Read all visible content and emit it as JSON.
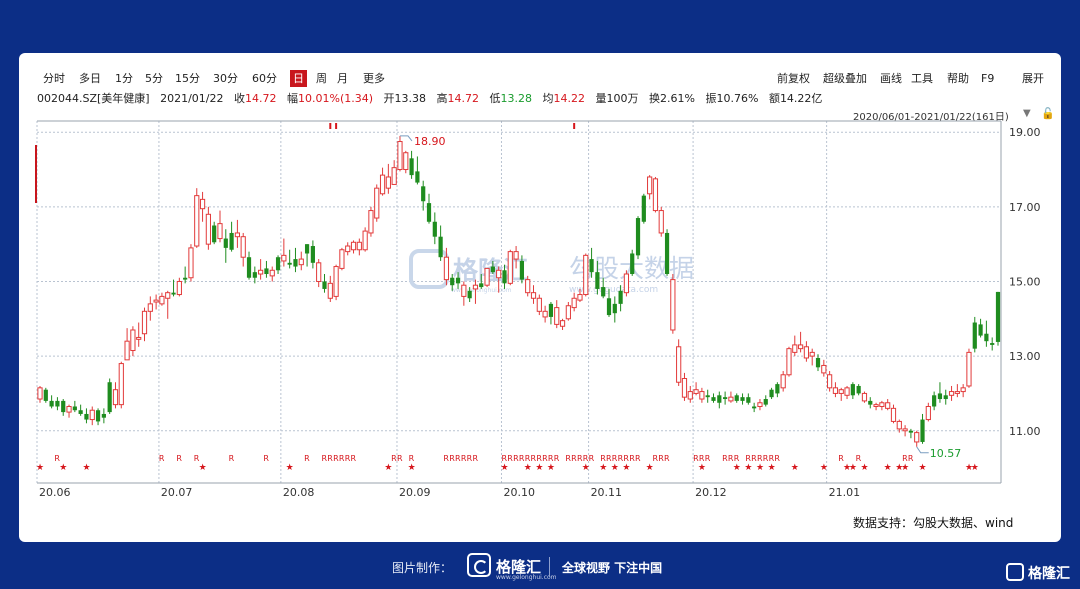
{
  "toolbar": {
    "left_items": [
      "分时",
      "多日",
      "1分",
      "5分",
      "15分",
      "30分",
      "60分",
      "日",
      "周",
      "月",
      "更多"
    ],
    "active_item": "日",
    "right_items": [
      "前复权",
      "超级叠加",
      "画线",
      "工具",
      "帮助",
      "F9",
      "展开"
    ]
  },
  "info": {
    "code_name": "002044.SZ[美年健康]",
    "date": "2021/01/22",
    "close_label": "收",
    "close": "14.72",
    "change_label": "幅",
    "change": "10.01%(1.34)",
    "open_label": "开",
    "open": "13.38",
    "high_label": "高",
    "high": "14.72",
    "low_label": "低",
    "low": "13.28",
    "avg_label": "均",
    "avg": "14.22",
    "vol_label": "量",
    "vol": "100万",
    "turnover_label": "换",
    "turnover": "2.61%",
    "amplitude_label": "振",
    "amplitude": "10.76%",
    "amount_label": "额",
    "amount": "14.22亿"
  },
  "range_label": "2020/06/01-2021/01/22(161日)",
  "range_arrow": "▼",
  "lock_icon": "🔓",
  "watermark": {
    "brand": "格隆汇",
    "brand_url": "www.gelonghui.com",
    "text": "勾股大数据",
    "url": "www.gogudata.com"
  },
  "source": "数据支持：勾股大数据、wind",
  "footer": {
    "made_by": "图片制作：",
    "brand": "格隆汇",
    "brand_url": "www.gelonghui.com",
    "slogan": "全球视野 下注中国",
    "brand_br": "格隆汇"
  },
  "chart_data": {
    "type": "candlestick",
    "ylim": [
      9.6,
      19.3
    ],
    "yticks": [
      "19.00",
      "17.00",
      "15.00",
      "13.00",
      "11.00"
    ],
    "ytick_values": [
      19,
      17,
      15,
      13,
      11
    ],
    "xticks": [
      "20.06",
      "20.07",
      "20.08",
      "20.09",
      "20.10",
      "20.11",
      "20.12",
      "21.01"
    ],
    "xtick_index": [
      0,
      21,
      42,
      62,
      80,
      95,
      113,
      136
    ],
    "max_label": "18.90",
    "min_label": "10.57",
    "colors": {
      "up": "#e23a3a",
      "down": "#1f8c1f",
      "grid": "#b9c3d1",
      "marker": "#d6161c"
    },
    "up_days": [
      0,
      5,
      9,
      13,
      14,
      15,
      16,
      17,
      18,
      19,
      20,
      21,
      22,
      24,
      26,
      27,
      28,
      29,
      31,
      34,
      35,
      38,
      40,
      42,
      45,
      48,
      50,
      51,
      52,
      53,
      54,
      55,
      56,
      57,
      58,
      59,
      60,
      61,
      62,
      63,
      70,
      73,
      75,
      77,
      79,
      81,
      82,
      84,
      85,
      86,
      87,
      89,
      90,
      91,
      92,
      93,
      94,
      101,
      105,
      106,
      107,
      109,
      110,
      111,
      112,
      113,
      114,
      119,
      124,
      128,
      129,
      130,
      131,
      132,
      133,
      135,
      136,
      137,
      138,
      139,
      142,
      144,
      145,
      146,
      147,
      148,
      149,
      151,
      153,
      157,
      158,
      159,
      160
    ],
    "ohlc": [
      [
        11.85,
        12.2,
        11.75,
        12.15
      ],
      [
        12.1,
        12.15,
        11.75,
        11.8
      ],
      [
        11.8,
        11.95,
        11.6,
        11.65
      ],
      [
        11.65,
        11.9,
        11.55,
        11.8
      ],
      [
        11.8,
        11.85,
        11.4,
        11.5
      ],
      [
        11.5,
        11.7,
        11.35,
        11.65
      ],
      [
        11.65,
        11.8,
        11.5,
        11.55
      ],
      [
        11.55,
        11.7,
        11.4,
        11.45
      ],
      [
        11.45,
        11.6,
        11.2,
        11.3
      ],
      [
        11.3,
        11.65,
        11.15,
        11.55
      ],
      [
        11.55,
        11.6,
        11.15,
        11.25
      ],
      [
        11.35,
        11.6,
        11.2,
        11.45
      ],
      [
        11.5,
        12.4,
        11.45,
        12.3
      ],
      [
        12.1,
        12.3,
        11.6,
        11.7
      ],
      [
        11.7,
        12.85,
        11.6,
        12.8
      ],
      [
        12.9,
        13.75,
        12.9,
        13.4
      ],
      [
        13.15,
        13.8,
        13.0,
        13.7
      ],
      [
        13.45,
        13.9,
        13.25,
        13.5
      ],
      [
        13.6,
        14.3,
        13.4,
        14.2
      ],
      [
        14.2,
        14.6,
        13.95,
        14.4
      ],
      [
        14.45,
        14.65,
        14.25,
        14.5
      ],
      [
        14.4,
        14.7,
        14.35,
        14.6
      ],
      [
        14.55,
        14.75,
        14.0,
        14.7
      ],
      [
        14.7,
        15.05,
        14.6,
        14.65
      ],
      [
        14.65,
        15.1,
        14.6,
        15.0
      ],
      [
        15.05,
        15.4,
        14.95,
        15.1
      ],
      [
        15.1,
        16.0,
        15.0,
        15.9
      ],
      [
        15.95,
        17.5,
        15.9,
        17.3
      ],
      [
        17.2,
        17.4,
        16.6,
        16.95
      ],
      [
        16.8,
        17.0,
        15.85,
        16.0
      ],
      [
        16.05,
        16.6,
        16.0,
        16.5
      ],
      [
        16.55,
        16.9,
        16.05,
        16.15
      ],
      [
        16.15,
        16.4,
        15.5,
        15.9
      ],
      [
        15.85,
        16.6,
        15.8,
        16.3
      ],
      [
        16.3,
        16.65,
        15.9,
        16.2
      ],
      [
        16.2,
        16.3,
        15.4,
        15.65
      ],
      [
        15.65,
        15.8,
        15.05,
        15.1
      ],
      [
        15.1,
        15.4,
        14.95,
        15.25
      ],
      [
        15.2,
        15.6,
        15.05,
        15.3
      ],
      [
        15.35,
        15.55,
        15.1,
        15.2
      ],
      [
        15.15,
        15.4,
        15.0,
        15.3
      ],
      [
        15.3,
        15.7,
        15.2,
        15.65
      ],
      [
        15.7,
        16.15,
        15.4,
        15.55
      ],
      [
        15.45,
        15.85,
        15.35,
        15.5
      ],
      [
        15.6,
        15.9,
        15.25,
        15.4
      ],
      [
        15.45,
        15.8,
        15.3,
        15.6
      ],
      [
        15.75,
        16.0,
        15.4,
        16.0
      ],
      [
        15.95,
        16.1,
        15.35,
        15.5
      ],
      [
        15.5,
        15.6,
        14.85,
        15.0
      ],
      [
        15.0,
        15.2,
        14.7,
        14.8
      ],
      [
        14.95,
        15.15,
        14.45,
        14.55
      ],
      [
        14.6,
        15.45,
        14.5,
        15.4
      ],
      [
        15.35,
        15.9,
        15.3,
        15.85
      ],
      [
        15.8,
        16.05,
        15.7,
        15.95
      ],
      [
        15.85,
        16.1,
        15.75,
        16.05
      ],
      [
        16.05,
        16.15,
        15.7,
        15.85
      ],
      [
        15.85,
        16.45,
        15.8,
        16.35
      ],
      [
        16.3,
        17.0,
        16.2,
        16.9
      ],
      [
        16.7,
        17.6,
        16.6,
        17.5
      ],
      [
        17.35,
        18.05,
        17.3,
        17.85
      ],
      [
        17.5,
        18.15,
        17.35,
        17.8
      ],
      [
        17.6,
        18.25,
        17.6,
        18.05
      ],
      [
        18.0,
        18.9,
        17.95,
        18.75
      ],
      [
        18.0,
        18.5,
        17.9,
        18.45
      ],
      [
        18.3,
        18.5,
        17.75,
        17.85
      ],
      [
        17.95,
        18.35,
        17.6,
        17.65
      ],
      [
        17.55,
        17.7,
        16.9,
        17.15
      ],
      [
        17.1,
        17.35,
        16.55,
        16.6
      ],
      [
        16.6,
        16.85,
        16.0,
        16.2
      ],
      [
        16.2,
        16.5,
        15.55,
        15.65
      ],
      [
        15.65,
        15.9,
        14.9,
        15.05
      ],
      [
        14.9,
        15.2,
        14.75,
        15.1
      ],
      [
        15.1,
        15.25,
        14.8,
        14.95
      ],
      [
        14.9,
        15.0,
        14.35,
        14.6
      ],
      [
        14.55,
        14.85,
        14.45,
        14.75
      ],
      [
        14.8,
        15.05,
        14.4,
        14.9
      ],
      [
        14.85,
        15.2,
        14.8,
        14.95
      ],
      [
        14.9,
        15.35,
        14.85,
        15.35
      ],
      [
        15.4,
        15.55,
        15.2,
        15.25
      ],
      [
        15.1,
        15.4,
        14.7,
        15.3
      ],
      [
        15.3,
        15.45,
        14.8,
        14.95
      ],
      [
        14.95,
        15.85,
        14.9,
        15.8
      ],
      [
        15.8,
        15.95,
        15.35,
        15.6
      ],
      [
        15.55,
        15.7,
        14.95,
        15.05
      ],
      [
        15.05,
        15.15,
        14.6,
        14.7
      ],
      [
        14.7,
        14.9,
        14.4,
        14.55
      ],
      [
        14.55,
        14.65,
        14.1,
        14.2
      ],
      [
        14.2,
        14.35,
        13.9,
        14.05
      ],
      [
        14.05,
        14.45,
        13.85,
        14.4
      ],
      [
        14.3,
        14.5,
        13.75,
        13.85
      ],
      [
        13.8,
        14.0,
        13.7,
        13.95
      ],
      [
        14.0,
        14.45,
        13.95,
        14.35
      ],
      [
        14.3,
        14.7,
        14.2,
        14.55
      ],
      [
        14.5,
        14.8,
        14.45,
        14.65
      ],
      [
        14.65,
        15.75,
        14.6,
        15.7
      ],
      [
        15.6,
        15.9,
        15.1,
        15.25
      ],
      [
        15.25,
        15.55,
        14.65,
        14.8
      ],
      [
        14.85,
        15.1,
        14.55,
        14.6
      ],
      [
        14.55,
        14.8,
        14.05,
        14.1
      ],
      [
        14.15,
        14.6,
        13.9,
        14.4
      ],
      [
        14.4,
        14.9,
        14.2,
        14.75
      ],
      [
        14.7,
        15.3,
        14.6,
        15.2
      ],
      [
        15.2,
        15.85,
        15.15,
        15.75
      ],
      [
        15.7,
        16.75,
        15.6,
        16.7
      ],
      [
        16.6,
        17.35,
        16.55,
        17.3
      ],
      [
        17.35,
        17.85,
        17.2,
        17.8
      ],
      [
        17.75,
        17.8,
        16.85,
        16.9
      ],
      [
        16.9,
        17.0,
        16.2,
        16.3
      ],
      [
        16.3,
        16.4,
        15.15,
        15.2
      ],
      [
        15.05,
        15.2,
        13.6,
        13.7
      ],
      [
        13.25,
        13.45,
        12.2,
        12.3
      ],
      [
        12.4,
        12.55,
        11.8,
        11.9
      ],
      [
        11.85,
        12.2,
        11.75,
        12.05
      ],
      [
        12.1,
        12.3,
        11.95,
        12.0
      ],
      [
        12.05,
        12.15,
        11.75,
        11.85
      ],
      [
        11.9,
        12.1,
        11.75,
        11.95
      ],
      [
        11.9,
        12.0,
        11.75,
        11.8
      ],
      [
        11.75,
        12.05,
        11.6,
        11.95
      ],
      [
        11.9,
        12.05,
        11.7,
        11.85
      ],
      [
        11.8,
        12.05,
        11.75,
        11.9
      ],
      [
        11.95,
        12.0,
        11.75,
        11.8
      ],
      [
        11.8,
        12.0,
        11.7,
        11.9
      ],
      [
        11.9,
        12.0,
        11.7,
        11.75
      ],
      [
        11.6,
        11.75,
        11.5,
        11.65
      ],
      [
        11.65,
        11.85,
        11.55,
        11.75
      ],
      [
        11.7,
        11.95,
        11.65,
        11.85
      ],
      [
        11.9,
        12.15,
        11.85,
        12.1
      ],
      [
        12.0,
        12.3,
        11.9,
        12.25
      ],
      [
        12.15,
        12.6,
        12.05,
        12.5
      ],
      [
        12.5,
        13.25,
        12.45,
        13.2
      ],
      [
        13.1,
        13.55,
        13.0,
        13.3
      ],
      [
        13.3,
        13.65,
        13.1,
        13.2
      ],
      [
        13.25,
        13.4,
        12.85,
        12.95
      ],
      [
        13.0,
        13.2,
        12.75,
        13.1
      ],
      [
        12.95,
        13.05,
        12.6,
        12.7
      ],
      [
        12.75,
        12.9,
        12.45,
        12.55
      ],
      [
        12.5,
        12.6,
        12.05,
        12.15
      ],
      [
        12.15,
        12.3,
        11.9,
        12.0
      ],
      [
        12.0,
        12.15,
        11.8,
        12.1
      ],
      [
        12.15,
        12.2,
        11.85,
        11.95
      ],
      [
        11.95,
        12.3,
        11.85,
        12.25
      ],
      [
        12.2,
        12.25,
        11.95,
        12.0
      ],
      [
        12.0,
        12.05,
        11.75,
        11.8
      ],
      [
        11.8,
        11.9,
        11.6,
        11.7
      ],
      [
        11.7,
        11.75,
        11.55,
        11.65
      ],
      [
        11.65,
        11.8,
        11.55,
        11.75
      ],
      [
        11.75,
        11.85,
        11.55,
        11.6
      ],
      [
        11.6,
        11.7,
        11.2,
        11.25
      ],
      [
        11.25,
        11.3,
        10.95,
        11.05
      ],
      [
        11.05,
        11.15,
        10.85,
        11.0
      ],
      [
        11.0,
        11.05,
        10.8,
        10.95
      ],
      [
        10.95,
        11.0,
        10.57,
        10.7
      ],
      [
        10.7,
        11.45,
        10.65,
        11.3
      ],
      [
        11.3,
        11.75,
        11.25,
        11.65
      ],
      [
        11.65,
        12.05,
        11.55,
        11.95
      ],
      [
        12.0,
        12.3,
        11.75,
        11.85
      ],
      [
        11.85,
        12.1,
        11.7,
        11.95
      ],
      [
        11.95,
        12.2,
        11.8,
        12.05
      ],
      [
        12.05,
        12.25,
        11.9,
        12.0
      ],
      [
        12.05,
        12.25,
        11.9,
        12.15
      ],
      [
        12.2,
        13.2,
        12.15,
        13.1
      ],
      [
        13.2,
        14.05,
        13.1,
        13.9
      ],
      [
        13.85,
        14.0,
        13.5,
        13.55
      ],
      [
        13.6,
        13.95,
        13.25,
        13.4
      ],
      [
        13.35,
        13.5,
        13.15,
        13.3
      ],
      [
        13.38,
        14.72,
        13.28,
        14.72
      ]
    ],
    "stars": [
      0,
      4,
      8,
      28,
      43,
      60,
      64,
      80,
      84,
      86,
      88,
      94,
      97,
      99,
      101,
      105,
      114,
      120,
      122,
      124,
      126,
      130,
      135,
      139,
      140,
      142,
      146,
      148,
      149,
      152,
      160,
      161
    ],
    "r_marks": [
      3,
      21,
      24,
      27,
      33,
      39,
      46,
      49,
      50,
      51,
      52,
      53,
      54,
      61,
      62,
      64,
      70,
      71,
      72,
      73,
      74,
      75,
      80,
      81,
      82,
      83,
      84,
      85,
      86,
      87,
      88,
      89,
      91,
      92,
      93,
      94,
      95,
      97,
      98,
      99,
      100,
      101,
      102,
      103,
      106,
      107,
      108,
      113,
      114,
      115,
      118,
      119,
      120,
      122,
      123,
      124,
      125,
      126,
      127,
      138,
      141,
      149,
      150
    ],
    "top_flags": [
      50,
      51,
      92
    ]
  }
}
